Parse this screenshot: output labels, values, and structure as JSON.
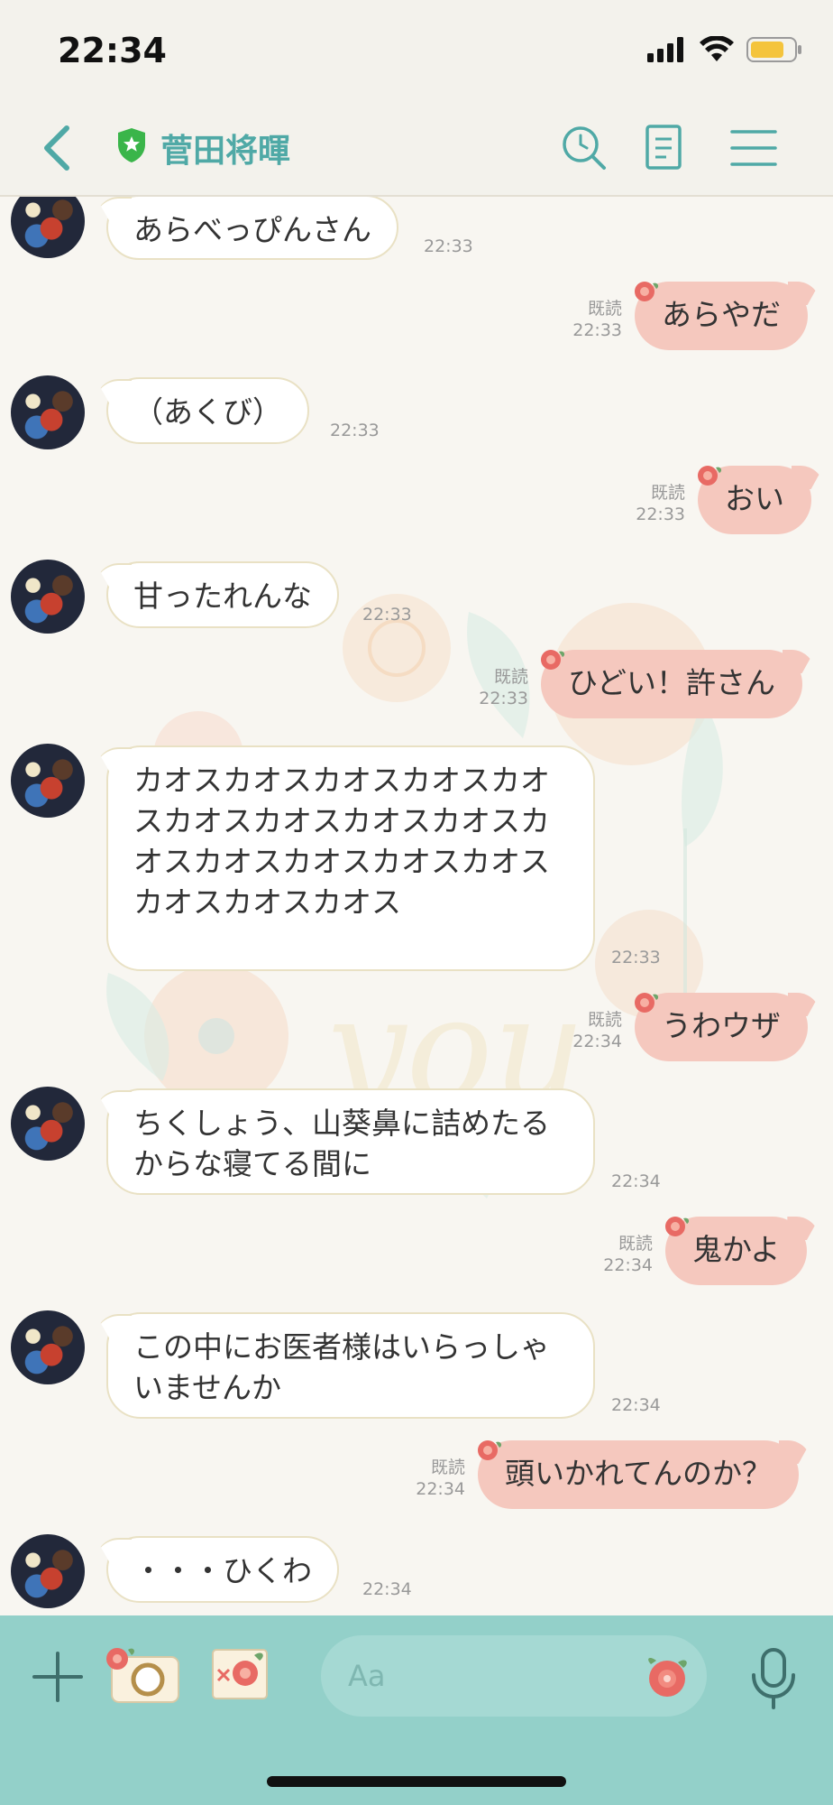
{
  "status_bar": {
    "time": "22:34"
  },
  "header": {
    "contact_name": "菅田将暉"
  },
  "messages": [
    {
      "side": "in",
      "text": "あらべっぴんさん",
      "time": "22:33"
    },
    {
      "side": "out",
      "text": "あらやだ",
      "read": "既読",
      "time": "22:33"
    },
    {
      "side": "in",
      "text": "（あくび）",
      "time": "22:33"
    },
    {
      "side": "out",
      "text": "おい",
      "read": "既読",
      "time": "22:33"
    },
    {
      "side": "in",
      "text": "甘ったれんな",
      "time": "22:33"
    },
    {
      "side": "out",
      "text": "ひどい！許さん",
      "read": "既読",
      "time": "22:33"
    },
    {
      "side": "in",
      "lines": [
        "カオスカオスカオスカオスカオ",
        "スカオスカオスカオスカオスカ",
        "オスカオスカオスカオスカオス",
        "カオスカオスカオス"
      ],
      "time": "22:33"
    },
    {
      "side": "out",
      "text": "うわウザ",
      "read": "既読",
      "time": "22:34"
    },
    {
      "side": "in",
      "lines": [
        "ちくしょう、山葵鼻に詰めたる",
        "からな寝てる間に"
      ],
      "time": "22:34"
    },
    {
      "side": "out",
      "text": "鬼かよ",
      "read": "既読",
      "time": "22:34"
    },
    {
      "side": "in",
      "lines": [
        "この中にお医者様はいらっしゃ",
        "いませんか"
      ],
      "time": "22:34"
    },
    {
      "side": "out",
      "text": "頭いかれてんのか？",
      "read": "既読",
      "time": "22:34"
    },
    {
      "side": "in",
      "text": "・・・ひくわ",
      "time": "22:34"
    }
  ],
  "input_bar": {
    "placeholder": "Aa"
  },
  "colors": {
    "accent": "#4fa9a6",
    "outgoing_bubble": "#f5c8be",
    "incoming_bubble": "#ffffff",
    "input_bar": "#93d0c9"
  }
}
